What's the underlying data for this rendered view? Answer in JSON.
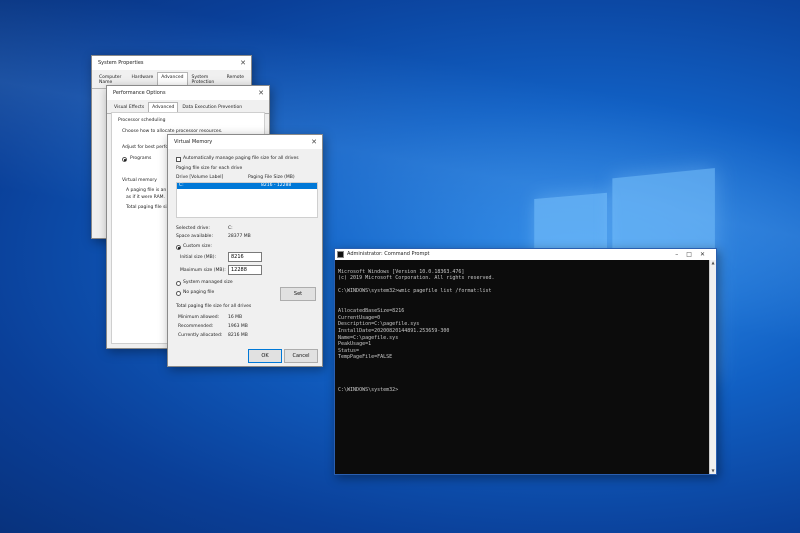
{
  "desktop": {
    "background": "#0a55b8",
    "accent": "#2f8be8"
  },
  "sysprops": {
    "title": "System Properties",
    "tabs": [
      "Computer Name",
      "Hardware",
      "Advanced",
      "System Protection",
      "Remote"
    ],
    "selected_tab": "Advanced"
  },
  "perf": {
    "title": "Performance Options",
    "tabs": [
      "Visual Effects",
      "Advanced",
      "Data Execution Prevention"
    ],
    "selected_tab": "Advanced",
    "group_processor": "Processor scheduling",
    "processor_desc": "Choose how to allocate processor resources.",
    "adjust_label": "Adjust for best perfo",
    "programs_label": "Programs",
    "vm_heading": "Virtual memory",
    "vm_desc1": "A paging file is an are",
    "vm_desc2": "as if it were RAM.",
    "total_size": "Total paging file size"
  },
  "vm": {
    "title": "Virtual Memory",
    "auto_manage": "Automatically manage paging file size for all drives",
    "paging_each": "Paging file size for each drive",
    "col_drive": "Drive  [Volume Label]",
    "col_size": "Paging File Size (MB)",
    "row_drive": "C:",
    "row_size": "8216 - 12288",
    "selected_drive_label": "Selected drive:",
    "selected_drive_value": "C:",
    "space_label": "Space available:",
    "space_value": "28377 MB",
    "custom_size": "Custom size:",
    "initial_label": "Initial size (MB):",
    "initial_value": "8216",
    "maximum_label": "Maximum size (MB):",
    "maximum_value": "12288",
    "system_managed": "System managed size",
    "no_paging": "No paging file",
    "set_button": "Set",
    "total_heading": "Total paging file size for all drives",
    "min_label": "Minimum allowed:",
    "min_value": "16 MB",
    "rec_label": "Recommended:",
    "rec_value": "1963 MB",
    "cur_label": "Currently allocated:",
    "cur_value": "8216 MB",
    "ok": "OK",
    "cancel": "Cancel"
  },
  "cmd": {
    "title": "Administrator: Command Prompt",
    "lines": [
      "Microsoft Windows [Version 10.0.18363.476]",
      "(c) 2019 Microsoft Corporation. All rights reserved.",
      "",
      "C:\\WINDOWS\\system32>wmic pagefile list /format:list",
      "",
      "",
      "AllocatedBaseSize=8216",
      "CurrentUsage=0",
      "Description=C:\\pagefile.sys",
      "InstallDate=20200820144891.253659-300",
      "Name=C:\\pagefile.sys",
      "PeakUsage=1",
      "Status=",
      "TempPageFile=FALSE",
      "",
      "",
      "",
      "",
      "C:\\WINDOWS\\system32>"
    ]
  }
}
